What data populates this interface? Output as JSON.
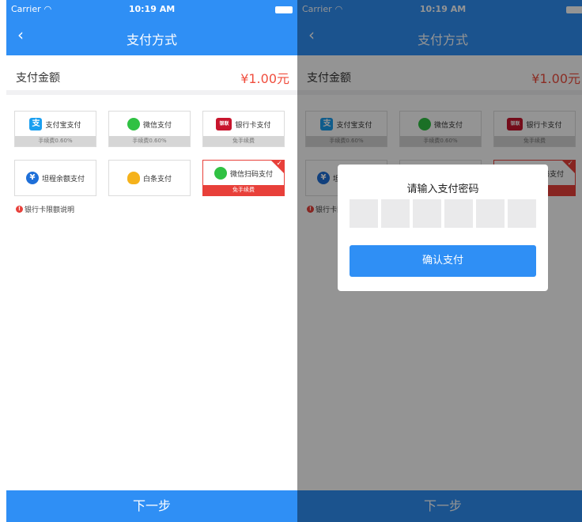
{
  "status_bar": {
    "carrier": "Carrier",
    "time": "10:19 AM"
  },
  "nav": {
    "back": "‹",
    "title": "支付方式"
  },
  "amount": {
    "label": "支付金额",
    "value": "¥1.00元"
  },
  "methods": [
    {
      "label": "支付宝支付",
      "fee": "手续费0.60%",
      "icon": "alipay-icon",
      "selected": false
    },
    {
      "label": "微信支付",
      "fee": "手续费0.60%",
      "icon": "wechat-icon",
      "selected": false
    },
    {
      "label": "银行卡支付",
      "fee": "免手续费",
      "icon": "unionpay-icon",
      "selected": false
    },
    {
      "label": "坦程余额支付",
      "fee": "",
      "icon": "balance-icon",
      "selected": false
    },
    {
      "label": "白条支付",
      "fee": "",
      "icon": "baitiao-icon",
      "selected": false
    },
    {
      "label": "微信扫码支付",
      "fee": "免手续费",
      "icon": "wechat-icon",
      "selected": true
    }
  ],
  "notice": "银行卡限额说明",
  "next_button": "下一步",
  "dialog": {
    "title": "请输入支付密码",
    "pin_length": 6,
    "confirm_label": "确认支付"
  },
  "icons": {
    "alipay": "支",
    "unionpay": "银联",
    "balance": "¥",
    "wechat": "",
    "baitiao": "",
    "notice": "!"
  },
  "colors": {
    "primary": "#2f8ff5",
    "price": "#f04e3e",
    "selected": "#e8403a"
  }
}
